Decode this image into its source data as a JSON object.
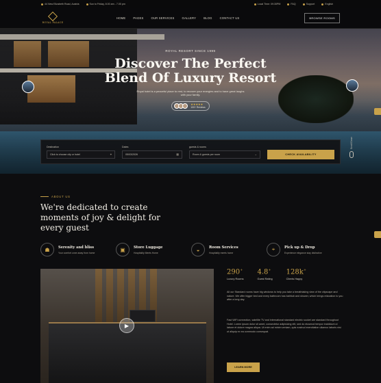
{
  "topbar": {
    "address": "44 New Elizabeth Road, Austria",
    "hours": "Sun to Friday, 8.00 am - 7.00 pm",
    "local_time": "Local Time: 09:30PM",
    "faq": "FAQ",
    "support": "Support",
    "language": "English"
  },
  "nav": {
    "logo_text": "ROYAL PALACE",
    "items": [
      "HOME",
      "PAGES",
      "OUR SERVICES",
      "GALLERY",
      "BLOG",
      "CONTACT US"
    ],
    "browse_label": "BROWSE ROOMS"
  },
  "hero": {
    "kicker": "ROYAL RESORT SINCE 1999",
    "title_line1": "Discover The Perfect",
    "title_line2": "Blend Of Luxury Resort",
    "description": "Royal hotel is a peaceful place to rest, to recover your energies and to have great laughs with your family.",
    "stars": "★★★★★",
    "review_count": "100+ Reviews"
  },
  "booking": {
    "destination_label": "Destination",
    "destination_value": "Click to choose city or hotel",
    "dates_label": "Dates",
    "dates_value": "05/03/2026",
    "guests_label": "guests & rooms",
    "guests_value": "Room & guests per room",
    "check_label": "CHECK AVAILABILITY",
    "scroll_label": "Scroll Down"
  },
  "about": {
    "kicker": "ABOUT US",
    "title": "We're dedicated to create moments of joy & delight for every guest",
    "features": [
      {
        "icon": "spa-icon",
        "glyph": "☗",
        "title": "Serenity and bliss",
        "subtitle": "Your comfort zone away from home"
      },
      {
        "icon": "luggage-icon",
        "glyph": "▣",
        "title": "Store Luggage",
        "subtitle": "Hospitality Meets Home"
      },
      {
        "icon": "room-service-icon",
        "glyph": "◒",
        "title": "Room Services",
        "subtitle": "Hospitality meets home"
      },
      {
        "icon": "pickup-icon",
        "glyph": "⌖",
        "title": "Pick up & Drop",
        "subtitle": "Experience elegance stay distinctive"
      }
    ]
  },
  "stats": [
    {
      "value": "290",
      "suffix": "+",
      "label": "Luxury Rooms"
    },
    {
      "value": "4.8",
      "suffix": "+",
      "label": "Guest Rating"
    },
    {
      "value": "128k",
      "suffix": "+",
      "label": "Clients Happy"
    }
  ],
  "content": {
    "para1": "All our Standard rooms have big windows to help you take a breathtaking view of the cityscape and nature. We offer bigger bed and every bathroom has bathtub and shower, which brings relaxation to you after a long day.",
    "para2": "Fast WiFi connection, satellite TV and international standard electric socket are standard throughout Hotel. Lorem ipsum dolor sit amet, consectetur adipisicing elit, sed do eiusmod tempor incididunt ut labore et dolore magna aliqua. Ut enim ad minim veniam, quis nostrud exercitation ullamco laboris nisi ut aliquip ex ea commodo consequat.",
    "learn_label": "LEARN MORE"
  },
  "colors": {
    "accent": "#c9a24a",
    "background": "#0d0d0f"
  }
}
